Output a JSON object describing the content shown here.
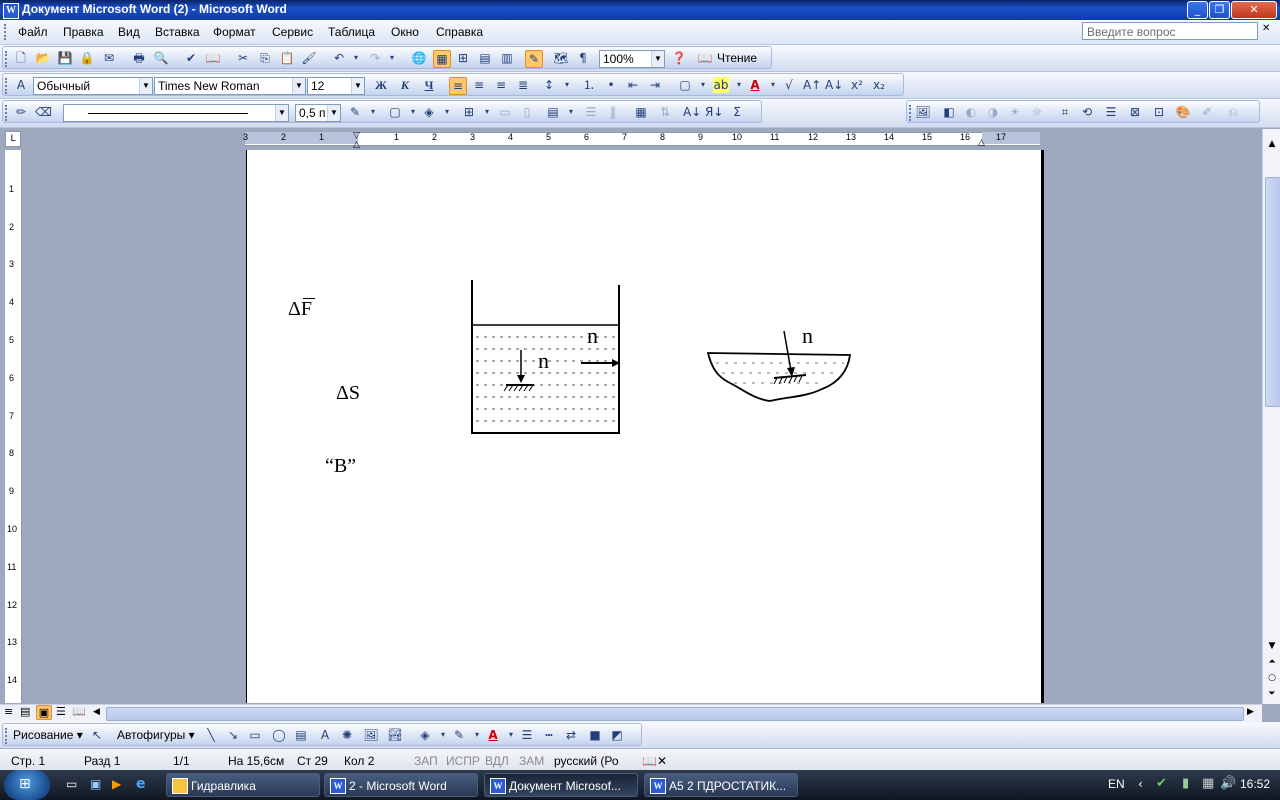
{
  "window": {
    "title": "Документ Microsoft Word (2) - Microsoft Word"
  },
  "menu": {
    "items": [
      "Файл",
      "Правка",
      "Вид",
      "Вставка",
      "Формат",
      "Сервис",
      "Таблица",
      "Окно",
      "Справка"
    ],
    "help_placeholder": "Введите вопрос"
  },
  "toolbar_standard": {
    "zoom": "100%",
    "reading_label": "Чтение"
  },
  "toolbar_format": {
    "style": "Обычный",
    "font": "Times New Roman",
    "size": "12",
    "bold": "Ж",
    "italic": "К",
    "underline": "Ч"
  },
  "toolbar_tables": {
    "line_weight": "0,5 п"
  },
  "ruler": {
    "h_left": [
      "3",
      "2",
      "1"
    ],
    "h_right": [
      "1",
      "2",
      "3",
      "4",
      "5",
      "6",
      "7",
      "8",
      "9",
      "10",
      "11",
      "12",
      "13",
      "14",
      "15",
      "16",
      "17"
    ],
    "v": [
      "1",
      "2",
      "3",
      "4",
      "5",
      "6",
      "7",
      "8",
      "9",
      "10",
      "11",
      "12",
      "13",
      "14"
    ]
  },
  "document": {
    "delta_f": "ΔF",
    "delta_s": "ΔS",
    "b_label": "“B”",
    "n1": "n",
    "n2": "n",
    "n3": "n"
  },
  "drawing": {
    "draw_label": "Рисование",
    "autoshapes_label": "Автофигуры"
  },
  "status": {
    "page": "Стр. 1",
    "section": "Разд 1",
    "pages": "1/1",
    "at": "На 15,6см",
    "line": "Ст 29",
    "col": "Кол 2",
    "rec": "ЗАП",
    "trk": "ИСПР",
    "ext": "ВДЛ",
    "ovr": "ЗАМ",
    "lang": "русский (Ро"
  },
  "taskbar": {
    "buttons": [
      "Гидравлика",
      "2 - Microsoft Word",
      "Документ Microsof...",
      "А5 2 ПДРОСТАТИК..."
    ],
    "lang": "EN",
    "time": "16:52"
  }
}
